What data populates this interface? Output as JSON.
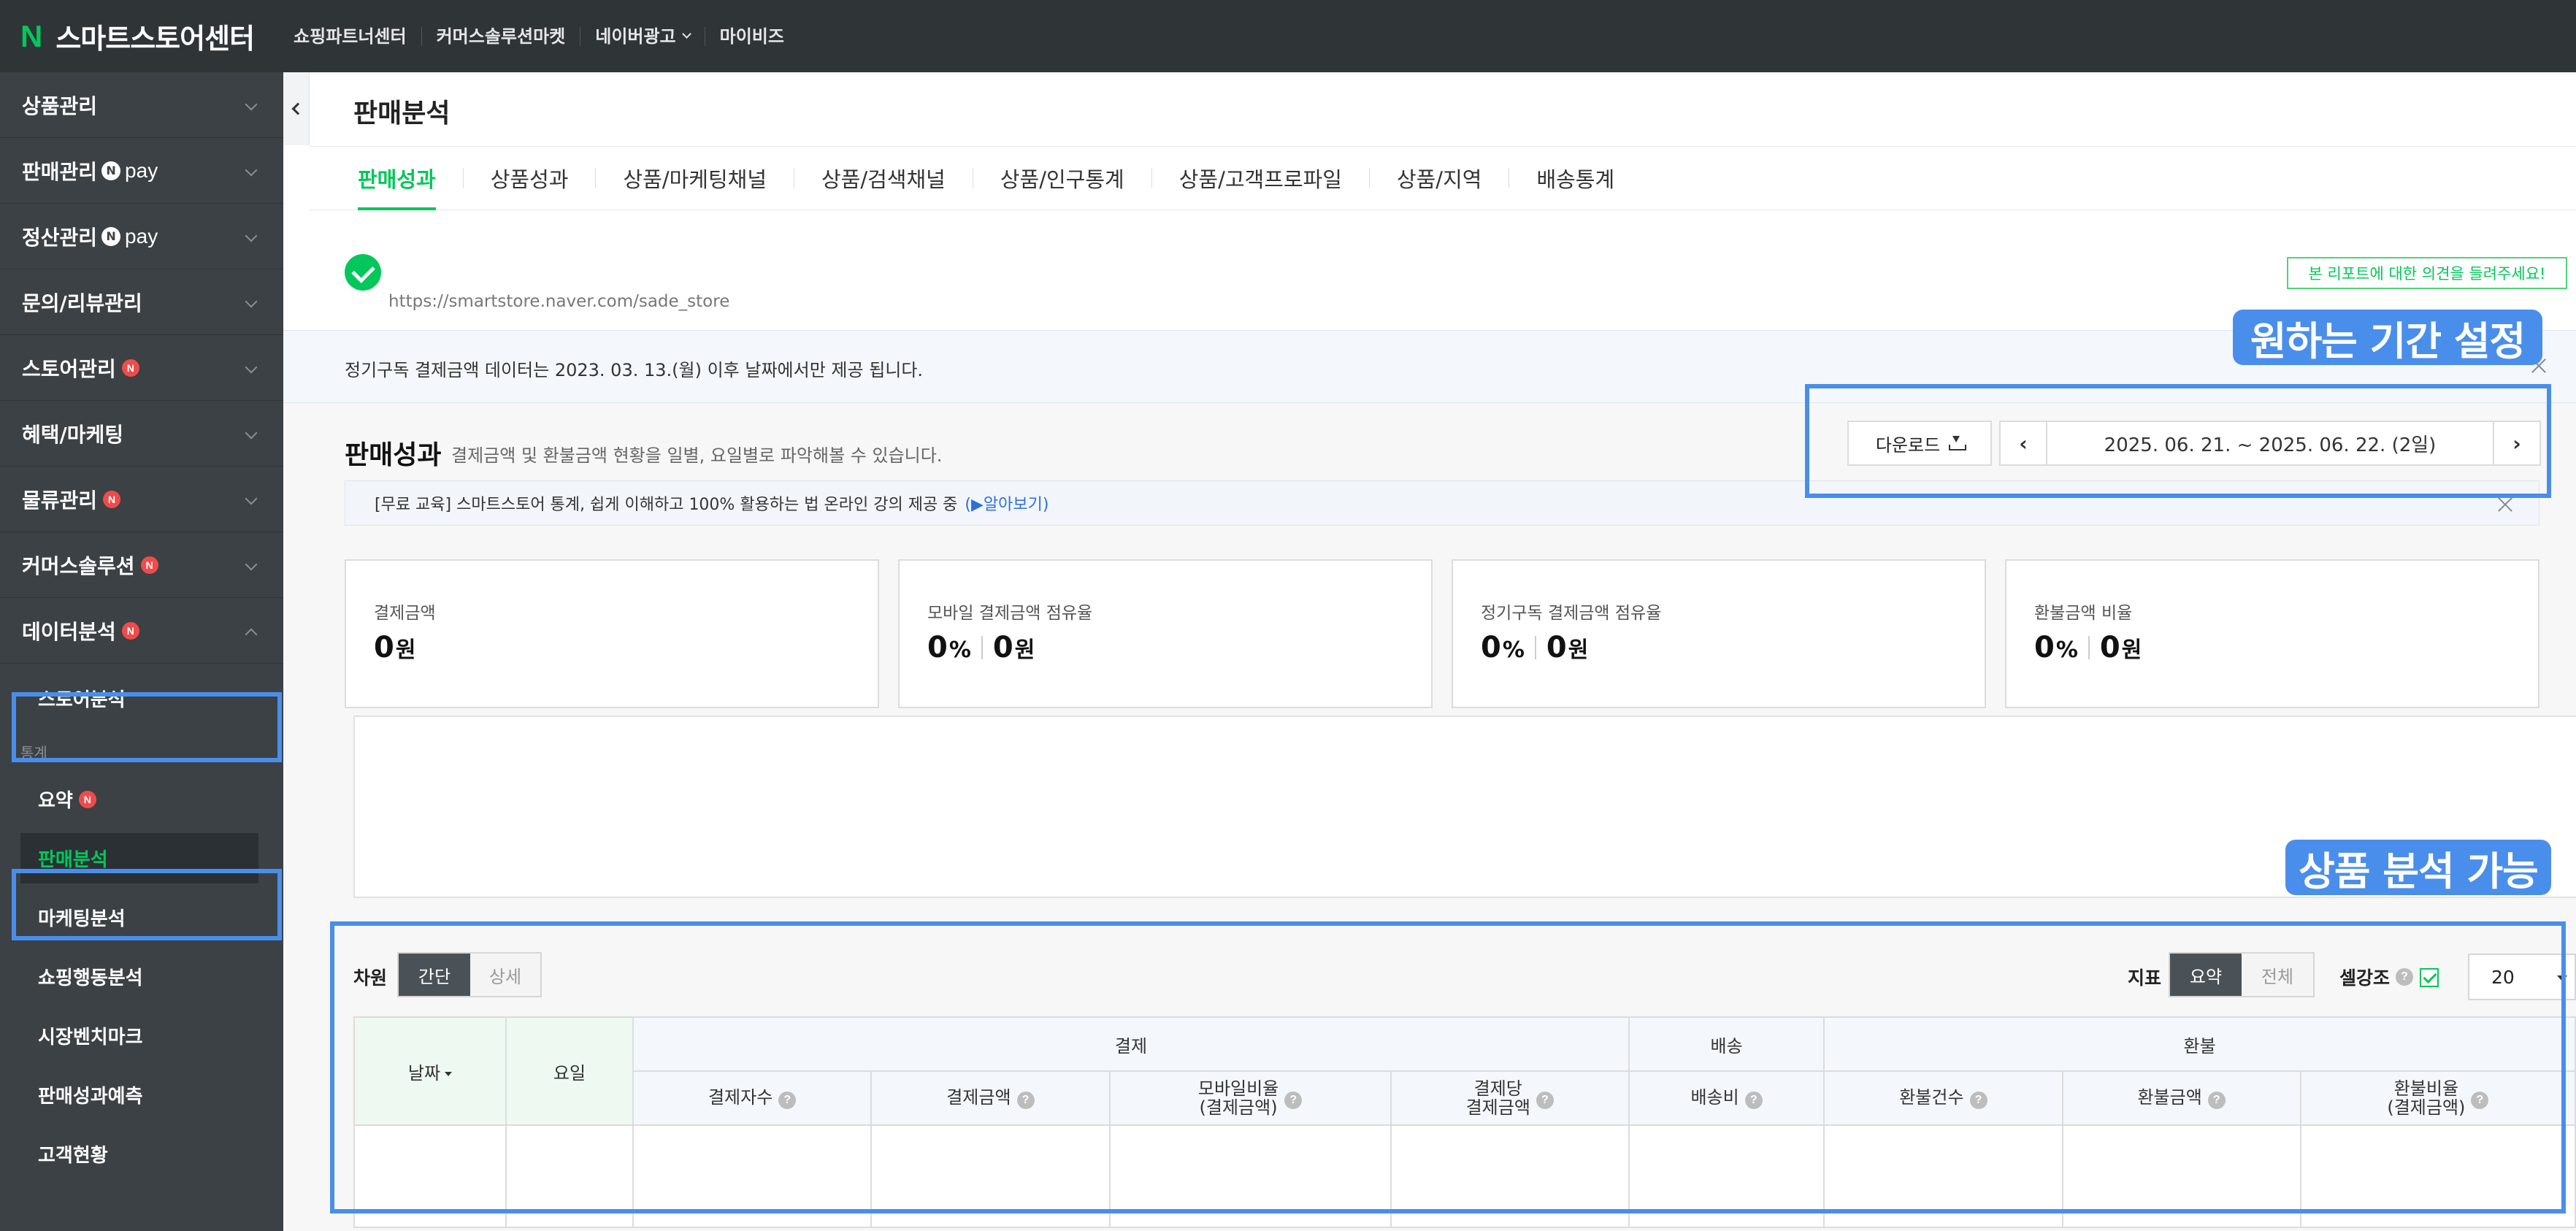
{
  "app": {
    "brand_letter": "N",
    "title": "스마트스토어센터"
  },
  "topnav": [
    {
      "label": "쇼핑파트너센터"
    },
    {
      "label": "커머스솔루션마켓"
    },
    {
      "label": "네이버광고"
    },
    {
      "label": "마이비즈"
    }
  ],
  "sidebar": {
    "items": [
      {
        "label": "상품관리"
      },
      {
        "label": "판매관리",
        "npay": "pay"
      },
      {
        "label": "정산관리",
        "npay": "pay"
      },
      {
        "label": "문의/리뷰관리"
      },
      {
        "label": "스토어관리",
        "badge": "N"
      },
      {
        "label": "혜택/마케팅"
      },
      {
        "label": "물류관리",
        "badge": "N"
      },
      {
        "label": "커머스솔루션",
        "badge": "N"
      },
      {
        "label": "데이터분석",
        "badge": "N"
      }
    ],
    "npay_letter": "N",
    "store_analysis": "스토어분석",
    "category": "통계",
    "sub_items": [
      {
        "label": "요약",
        "badge": "N"
      },
      {
        "label": "판매분석"
      },
      {
        "label": "마케팅분석"
      },
      {
        "label": "쇼핑행동분석"
      },
      {
        "label": "시장벤치마크"
      },
      {
        "label": "판매성과예측"
      },
      {
        "label": "고객현황"
      }
    ]
  },
  "page": {
    "title": "판매분석"
  },
  "tabs": [
    "판매성과",
    "상품성과",
    "상품/마케팅채널",
    "상품/검색채널",
    "상품/인구통계",
    "상품/고객프로파일",
    "상품/지역",
    "배송통계"
  ],
  "store": {
    "url": "https://smartstore.naver.com/sade_store",
    "feedback": "본 리포트에 대한 의견을 들려주세요!"
  },
  "notice": "정기구독 결제금액 데이터는 2023. 03. 13.(월) 이후 날짜에서만 제공 됩니다.",
  "section": {
    "title": "판매성과",
    "desc": "결제금액 및 환불금액 현황을 일별, 요일별로 파악해볼 수 있습니다.",
    "download": "다운로드",
    "prev": "‹",
    "next": "›",
    "date_range": "2025. 06. 21. ~ 2025. 06. 22. (2일)",
    "edu_text": "[무료 교육] 스마트스토어 통계, 쉽게 이해하고 100% 활용하는 법 온라인 강의 제공 중",
    "edu_link": "(▶알아보기)"
  },
  "cards": [
    {
      "label": "결제금액",
      "value": "0",
      "unit": "원"
    },
    {
      "label": "모바일 결제금액 점유율",
      "pct": "0",
      "pct_unit": "%",
      "value": "0",
      "unit": "원"
    },
    {
      "label": "정기구독 결제금액 점유율",
      "pct": "0",
      "pct_unit": "%",
      "value": "0",
      "unit": "원"
    },
    {
      "label": "환불금액 비율",
      "pct": "0",
      "pct_unit": "%",
      "value": "0",
      "unit": "원"
    }
  ],
  "controls": {
    "dimension_label": "차원",
    "dimension_options": [
      "간단",
      "상세"
    ],
    "metric_label": "지표",
    "metric_options": [
      "요약",
      "전체"
    ],
    "highlight_label": "셀강조",
    "help": "?",
    "page_size": "20"
  },
  "table": {
    "date_header": "날짜",
    "day_header": "요일",
    "groups": [
      "결제",
      "배송",
      "환불"
    ],
    "columns": [
      {
        "line1": "결제자수",
        "line2": ""
      },
      {
        "line1": "결제금액",
        "line2": ""
      },
      {
        "line1": "모바일비율",
        "line2": "(결제금액)"
      },
      {
        "line1": "결제당",
        "line2": "결제금액"
      },
      {
        "line1": "배송비",
        "line2": ""
      },
      {
        "line1": "환불건수",
        "line2": ""
      },
      {
        "line1": "환불금액",
        "line2": ""
      },
      {
        "line1": "환불비율",
        "line2": "(결제금액)"
      }
    ]
  },
  "callouts": {
    "period": "원하는 기간 설정",
    "product": "상품 분석 가능"
  },
  "colors": {
    "accent": "#03c75a",
    "highlight": "#4a8eeb",
    "topbar": "#2f3437",
    "sidebar": "#3b4145",
    "badge": "#f04b4b"
  }
}
